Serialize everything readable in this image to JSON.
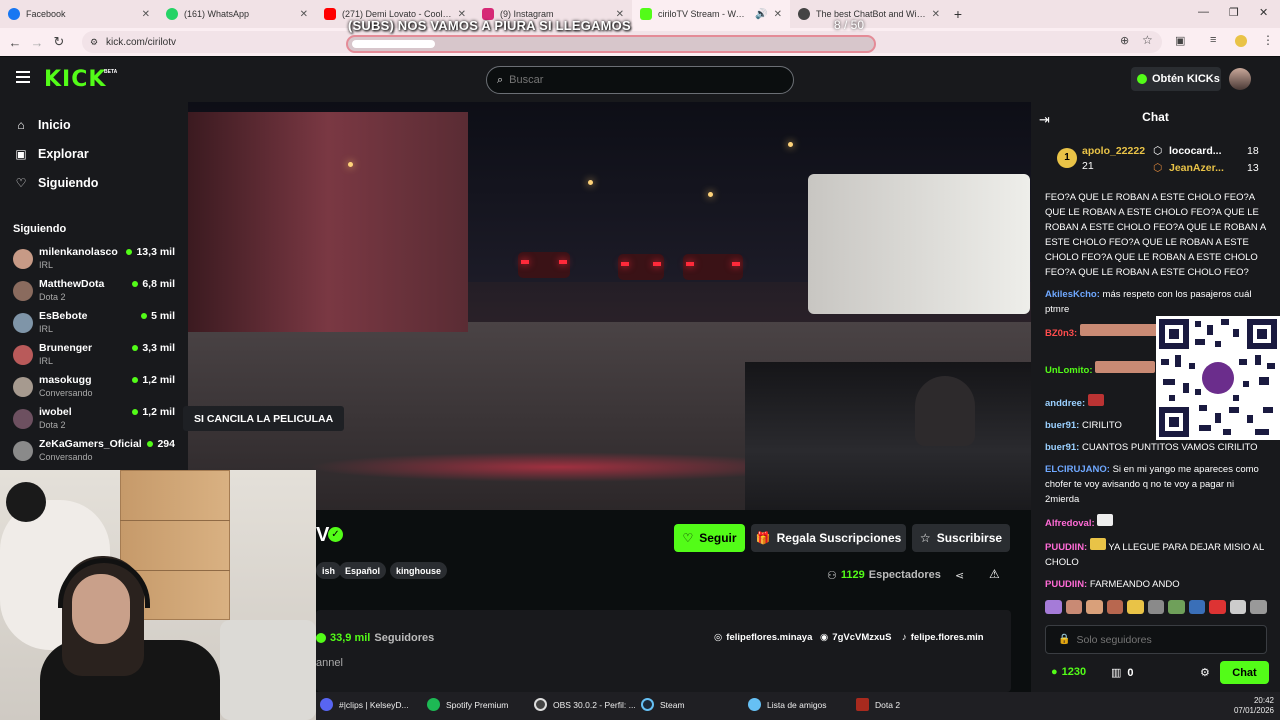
{
  "browser": {
    "tabs": [
      {
        "label": "Facebook",
        "color": "#1877f2"
      },
      {
        "label": "(161) WhatsApp",
        "color": "#25d366"
      },
      {
        "label": "(271) Demi Lovato - Cool for the Sum...",
        "color": "#ff0000"
      },
      {
        "label": "(9) Instagram",
        "color": "#d62976"
      },
      {
        "label": "ciriloTV Stream - Watch Live on Kick",
        "color": "#53fc18"
      },
      {
        "label": "The best ChatBot and Widgets",
        "color": "#444444"
      }
    ],
    "url": "kick.com/cirilotv"
  },
  "overlay": {
    "goal_text": "(SUBS) NOS VAMOS A PIURA SI LLEGAMOS",
    "goal_count": "8 / 50",
    "goal_fraction": 0.16
  },
  "header": {
    "logo": "KICK",
    "logo_badge": "BETA",
    "search_placeholder": "Buscar",
    "kicks_button": "Obtén KICKs",
    "brand_color": "#53fc18"
  },
  "sidebar": {
    "nav": [
      {
        "label": "Inicio",
        "icon": "home-icon"
      },
      {
        "label": "Explorar",
        "icon": "compass-icon"
      },
      {
        "label": "Siguiendo",
        "icon": "heart-icon"
      }
    ],
    "following_title": "Siguiendo",
    "channels": [
      {
        "name": "milenkanolasco",
        "game": "IRL",
        "viewers": "13,3 mil",
        "color": "#c79a86"
      },
      {
        "name": "MatthewDota",
        "game": "Dota 2",
        "viewers": "6,8 mil",
        "color": "#8a6b5e"
      },
      {
        "name": "EsBebote",
        "game": "IRL",
        "viewers": "5 mil",
        "color": "#7f95a8"
      },
      {
        "name": "Brunenger",
        "game": "IRL",
        "viewers": "3,3 mil",
        "color": "#b95a5a"
      },
      {
        "name": "masokugg",
        "game": "Conversando",
        "viewers": "1,2 mil",
        "color": "#a69a8f"
      },
      {
        "name": "iwobel",
        "game": "Dota 2",
        "viewers": "1,2 mil",
        "color": "#6d5060"
      },
      {
        "name": "ZeKaGamers_Oficial",
        "game": "Conversando",
        "viewers": "294",
        "color": "#8a8a8a"
      }
    ]
  },
  "video": {
    "tooltip": "SI CANCILA LA PELICULAA"
  },
  "channel": {
    "title_tail": "V",
    "tags": [
      "ish",
      "Español",
      "kinghouse"
    ],
    "follow_label": "Seguir",
    "gift_label": "Regala Suscripciones",
    "subscribe_label": "Suscribirse",
    "viewers_count": "1129",
    "viewers_label": "Espectadores",
    "followers_count": "33,9 mil",
    "followers_label": "Seguidores",
    "about_sub": "annel",
    "socials": [
      {
        "label": "felipeflores.minaya",
        "icon": "instagram-icon"
      },
      {
        "label": "7gVcVMzxuS",
        "icon": "discord-icon"
      },
      {
        "label": "felipe.flores.min",
        "icon": "tiktok-icon"
      }
    ]
  },
  "chat": {
    "title": "Chat",
    "leaders": [
      {
        "name": "apolo_22222",
        "count": "21",
        "color": "#e9c347"
      },
      {
        "name": "lococard...",
        "count": "18",
        "color": "#ffffff"
      },
      {
        "name": "JeanAzer...",
        "count": "13",
        "color": "#e9c347"
      }
    ],
    "messages": [
      {
        "user": "",
        "text": "FEO?A QUE LE ROBAN A ESTE CHOLO FEO?A QUE LE ROBAN A ESTE CHOLO FEO?A QUE LE ROBAN A ESTE CHOLO FEO?A QUE LE ROBAN A ESTE CHOLO FEO?A QUE LE ROBAN A ESTE CHOLO FEO?A QUE LE ROBAN A ESTE CHOLO FEO?A QUE LE ROBAN A ESTE CHOLO FEO?",
        "color": "#ffffff"
      },
      {
        "user": "AkilesKcho:",
        "text": "más respeto con los pasajeros cuál ptmre",
        "color": "#6fa8ff"
      },
      {
        "user": "BZ0n3:",
        "text": "",
        "color": "#ff4d4d"
      },
      {
        "user": "UnLomito:",
        "text": "",
        "color": "#53fc18"
      },
      {
        "user": "anddree:",
        "text": "",
        "color": "#9ad0ff"
      },
      {
        "user": "buer91:",
        "text": "CIRILITO",
        "color": "#9ad0ff"
      },
      {
        "user": "buer91:",
        "text": "CUANTOS PUNTITOS VAMOS CIRILITO",
        "color": "#9ad0ff"
      },
      {
        "user": "ELCIRUJANO:",
        "text": "Si en mi yango me apareces como chofer te voy avisando q no te voy a pagar ni 2mierda",
        "color": "#6fa8ff"
      },
      {
        "user": "Alfredoval:",
        "text": "",
        "color": "#ff6bd6"
      },
      {
        "user": "PUUDIIN:",
        "text": "YA LLEGUE PARA DEJAR MISIO AL CHOLO",
        "color": "#ff6bd6"
      },
      {
        "user": "PUUDIIN:",
        "text": "FARMEANDO ANDO",
        "color": "#ff6bd6"
      }
    ],
    "input_placeholder": "Solo seguidores",
    "kicks_balance": "1230",
    "gifts_balance": "0",
    "send_label": "Chat"
  },
  "taskbar": {
    "items": [
      {
        "label": "#|clips | KelseyD...",
        "color": "#5865f2"
      },
      {
        "label": "Spotify Premium",
        "color": "#1db954"
      },
      {
        "label": "OBS 30.0.2 - Perfil: ...",
        "color": "#444444"
      },
      {
        "label": "Steam",
        "color": "#1b2838"
      },
      {
        "label": "Lista de amigos",
        "color": "#66c0f4"
      },
      {
        "label": "Dota 2",
        "color": "#a82a1e"
      }
    ],
    "time": "20:42",
    "date": "07/01/2026"
  }
}
